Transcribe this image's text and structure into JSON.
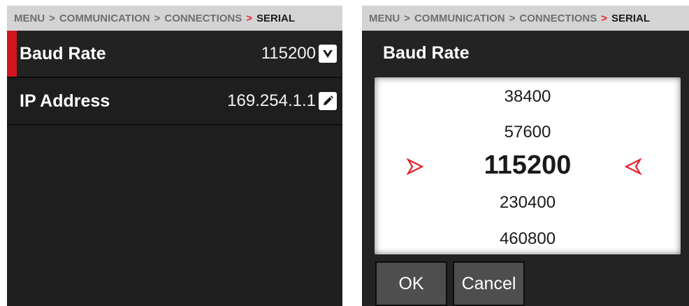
{
  "breadcrumb": {
    "items": [
      "MENU",
      "COMMUNICATION",
      "CONNECTIONS",
      "SERIAL"
    ],
    "separator": ">"
  },
  "menu": {
    "rows": [
      {
        "label": "Baud Rate",
        "value": "115200",
        "icon": "chevron-down-icon"
      },
      {
        "label": "IP Address",
        "value": "169.254.1.1",
        "icon": "pencil-icon"
      }
    ]
  },
  "dialog": {
    "title": "Baud Rate",
    "options": [
      "38400",
      "57600",
      "115200",
      "230400",
      "460800"
    ],
    "selected": "115200",
    "ok_label": "OK",
    "cancel_label": "Cancel"
  },
  "colors": {
    "accent": "#d0161f",
    "panel_bg": "#1e1e1e",
    "breadcrumb_bg": "#d4d4d4",
    "button_bg": "#4e4e4e"
  }
}
